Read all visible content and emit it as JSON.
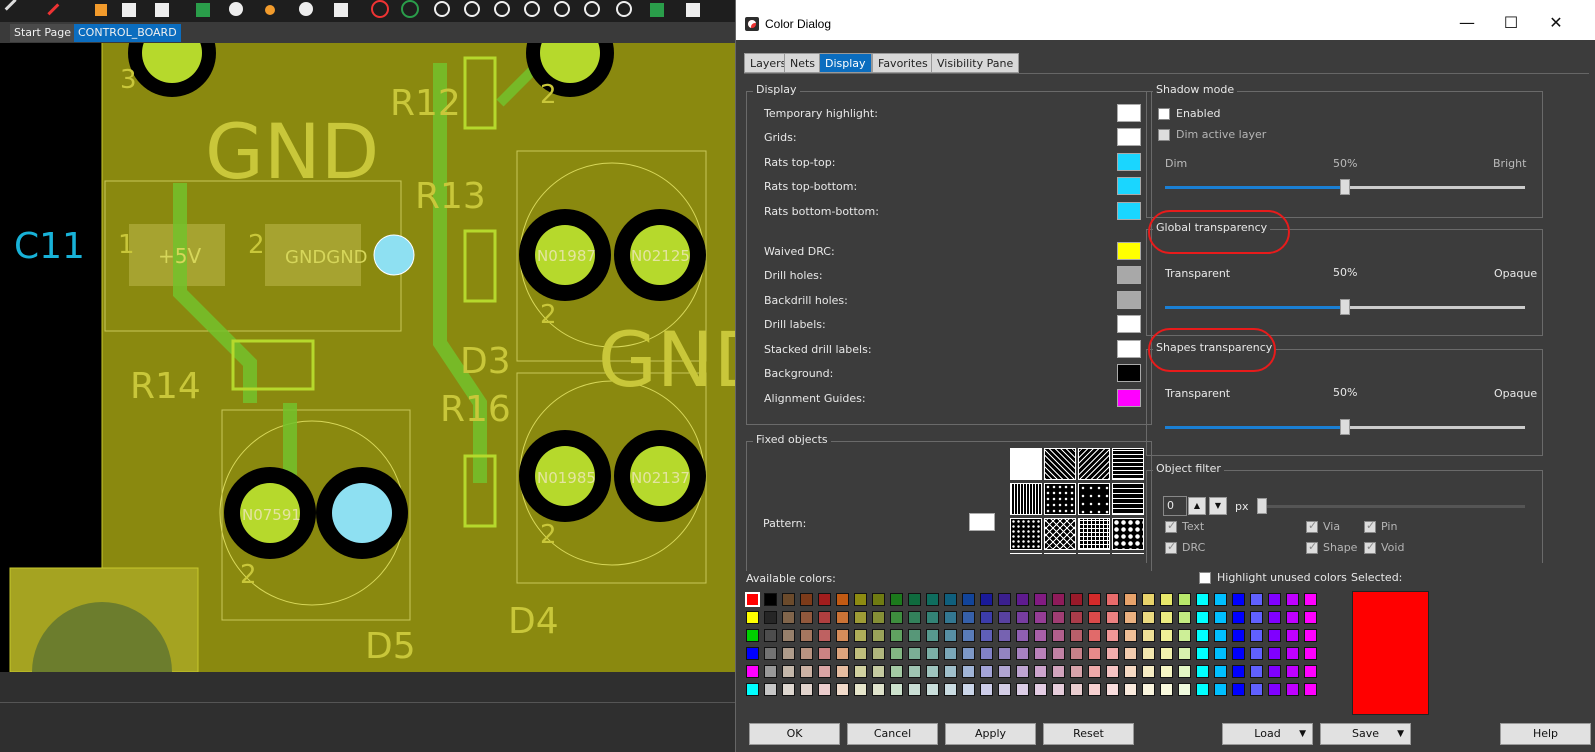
{
  "document_tabs": [
    "Start Page",
    "CONTROL_BOARD"
  ],
  "pcb": {
    "silk_labels": [
      "GND",
      "GND",
      "C11",
      "R12",
      "R13",
      "R14",
      "R16",
      "D3",
      "D4",
      "D5",
      "+5V",
      "GNDGND"
    ],
    "net_labels": [
      "N01987",
      "N02125",
      "N01985",
      "N02137",
      "N07591"
    ],
    "pin_numbers": [
      "1",
      "2",
      "2",
      "2",
      "2",
      "2",
      "3"
    ]
  },
  "dialog": {
    "title": "Color Dialog",
    "window_controls": {
      "minimize": "—",
      "maximize": "☐",
      "close": "✕"
    },
    "tabs": [
      "Layers",
      "Nets",
      "Display",
      "Favorites",
      "Visibility Pane"
    ],
    "active_tab": "Display",
    "display_group": {
      "title": "Display",
      "rows": [
        {
          "label": "Temporary highlight:",
          "color": "#ffffff"
        },
        {
          "label": "Grids:",
          "color": "#ffffff"
        },
        {
          "label": "Rats top-top:",
          "color": "#1ad6ff"
        },
        {
          "label": "Rats top-bottom:",
          "color": "#1ad6ff"
        },
        {
          "label": "Rats bottom-bottom:",
          "color": "#1ad6ff"
        },
        {
          "label": "Waived DRC:",
          "color": "#ffff00"
        },
        {
          "label": "Drill holes:",
          "color": "#a8a8a8"
        },
        {
          "label": "Backdrill holes:",
          "color": "#a8a8a8"
        },
        {
          "label": "Drill labels:",
          "color": "#ffffff"
        },
        {
          "label": "Stacked drill labels:",
          "color": "#ffffff"
        },
        {
          "label": "Background:",
          "color": "#000000"
        },
        {
          "label": "Alignment Guides:",
          "color": "#ff00ff"
        }
      ]
    },
    "fixed_objects": {
      "title": "Fixed objects",
      "pattern_label": "Pattern:",
      "pattern_color": "#ffffff"
    },
    "shadow_mode": {
      "title": "Shadow mode",
      "enabled_label": "Enabled",
      "enabled": false,
      "dim_active_label": "Dim active layer",
      "dim_active": false,
      "left_label": "Dim",
      "center_label": "50%",
      "right_label": "Bright",
      "value": 0.5
    },
    "global_transparency": {
      "title": "Global transparency",
      "left_label": "Transparent",
      "center_label": "50%",
      "right_label": "Opaque",
      "value": 0.5
    },
    "shapes_transparency": {
      "title": "Shapes transparency",
      "left_label": "Transparent",
      "center_label": "50%",
      "right_label": "Opaque",
      "value": 0.5
    },
    "object_filter": {
      "title": "Object filter",
      "size_value": "0",
      "unit": "px",
      "checks": [
        {
          "label": "Text",
          "checked": true
        },
        {
          "label": "Via",
          "checked": true
        },
        {
          "label": "Pin",
          "checked": true
        },
        {
          "label": "DRC",
          "checked": true
        },
        {
          "label": "Shape",
          "checked": true
        },
        {
          "label": "Void",
          "checked": true
        }
      ]
    },
    "available_colors_label": "Available colors:",
    "highlight_unused_label": "Highlight unused colors",
    "highlight_unused": false,
    "selected_label": "Selected:",
    "selected_color": "#ff0000",
    "buttons": {
      "ok": "OK",
      "cancel": "Cancel",
      "apply": "Apply",
      "reset": "Reset",
      "load": "Load",
      "save": "Save",
      "help": "Help"
    }
  }
}
